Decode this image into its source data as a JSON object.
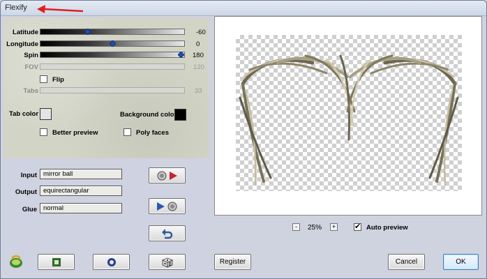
{
  "window": {
    "title": "Flexify"
  },
  "params": {
    "latitude": {
      "label": "Latitude",
      "value": "-60",
      "fraction": 0.33
    },
    "longitude": {
      "label": "Longitude",
      "value": "0",
      "fraction": 0.5
    },
    "spin": {
      "label": "Spin",
      "value": "180",
      "fraction": 1.0
    },
    "fov": {
      "label": "FOV",
      "value": "120"
    },
    "flip": {
      "label": "Flip",
      "checked": false
    },
    "tabs": {
      "label": "Tabs",
      "value": "33"
    }
  },
  "colors": {
    "tab_color": {
      "label": "Tab color",
      "value": "#e4e4e4"
    },
    "background_color": {
      "label": "Background color",
      "value": "#000000"
    }
  },
  "options": {
    "better_preview": {
      "label": "Better preview",
      "checked": false
    },
    "poly_faces": {
      "label": "Poly faces",
      "checked": false
    }
  },
  "mapping": {
    "input": {
      "label": "Input",
      "value": "mirror ball"
    },
    "output": {
      "label": "Output",
      "value": "equirectangular"
    },
    "glue": {
      "label": "Glue",
      "value": "normal"
    }
  },
  "zoom": {
    "minus": "-",
    "value": "25%",
    "plus": "+"
  },
  "auto_preview": {
    "label": "Auto preview",
    "checked": true
  },
  "buttons": {
    "register": "Register",
    "cancel": "Cancel",
    "ok": "OK"
  },
  "icons": {
    "logo": "flexify-logo-icon",
    "square": "square-icon",
    "circle": "circle-icon",
    "dice": "dice-icon",
    "undo": "undo-icon",
    "arrow_out": "swap-arrow-right-icon",
    "arrow_in": "swap-arrow-left-icon"
  }
}
